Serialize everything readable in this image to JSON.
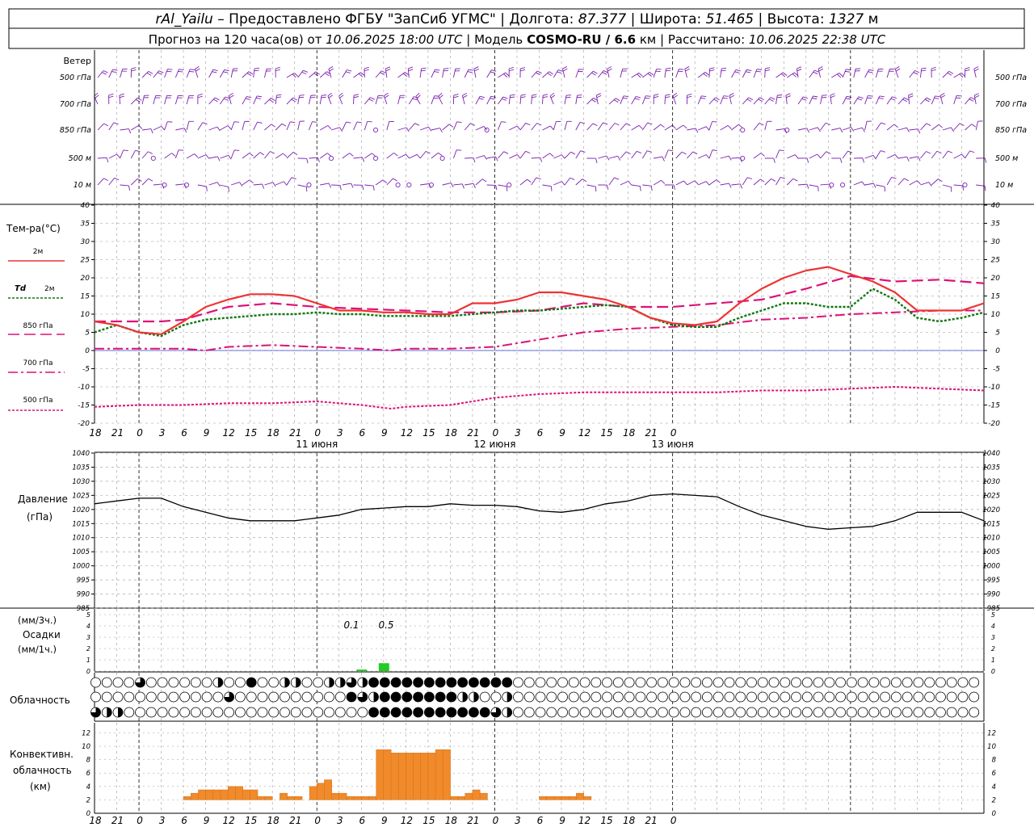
{
  "header": {
    "station": "rAl_Yailu",
    "provider": "Предоставлено ФГБУ \"ЗапСиб УГМС\"",
    "lon_label": "Долгота:",
    "lon": "87.377",
    "lat_label": "Широта:",
    "lat": "51.465",
    "alt_label": "Высота:",
    "alt": "1327",
    "alt_unit": "м",
    "forecast_prefix": "Прогноз на 120 часа(ов) от",
    "forecast_start": "10.06.2025 18:00 UTC",
    "model_label": "Модель",
    "model": "COSMO-RU / 6.6",
    "model_unit": "км",
    "calc_label": "Рассчитано:",
    "calc_time": "10.06.2025 22:38 UTC"
  },
  "time_axis": {
    "hour_labels": [
      "18",
      "21",
      "0",
      "3",
      "6",
      "9",
      "12",
      "15",
      "18",
      "21",
      "0",
      "3",
      "6",
      "9",
      "12",
      "15",
      "18",
      "21",
      "0",
      "3",
      "6",
      "9",
      "12",
      "15",
      "18",
      "21",
      "0"
    ],
    "day_labels": [
      "11 июня",
      "12 июня",
      "13 июня"
    ]
  },
  "wind_panel": {
    "title": "Ветер",
    "levels": [
      "500 гПа",
      "700 гПа",
      "850 гПа",
      "500 м",
      "10 м"
    ]
  },
  "temperature_panel": {
    "title": "Тем-ра(°С)",
    "legend": [
      {
        "label": "2м",
        "color": "#ee3333",
        "style": "solid"
      },
      {
        "label_italic": "Td",
        "label": "2м",
        "color": "#117711",
        "style": "dotted"
      },
      {
        "label": "850 гПа",
        "color": "#dd1177",
        "style": "long-dash"
      },
      {
        "label": "700 гПа",
        "color": "#dd1177",
        "style": "dash-dot"
      },
      {
        "label": "500 гПа",
        "color": "#dd1177",
        "style": "short-dash"
      }
    ]
  },
  "pressure_panel": {
    "title": "Давление",
    "unit": "(гПа)"
  },
  "precip_panel": {
    "unit_3h": "(мм/3ч.)",
    "title": "Осадки",
    "unit_1h": "(мм/1ч.)",
    "annotations": [
      "0.1",
      "0.5"
    ]
  },
  "cloud_panel": {
    "title": "Облачность"
  },
  "convective_panel": {
    "title_line1": "Конвективн.",
    "title_line2": "облачность",
    "unit": "(км)"
  },
  "colors": {
    "frame": "#000000",
    "grid": "#999999",
    "wind": "#7a1fb0",
    "t2m": "#ee3333",
    "td2m": "#117711",
    "upper": "#dd1177",
    "zero_line": "#3344cc",
    "precip": "#22cc22",
    "convective": "#f08a2a"
  },
  "chart_data": [
    {
      "type": "line",
      "panel": "temperature",
      "x_unit": "hours from 10.06.2025 18:00 UTC",
      "ylim": [
        -20,
        40
      ],
      "yticks": [
        -20,
        -15,
        -10,
        -5,
        0,
        5,
        10,
        15,
        20,
        25,
        30,
        35,
        40
      ],
      "series": [
        {
          "name": "2м",
          "x": [
            0,
            3,
            6,
            9,
            12,
            15,
            18,
            21,
            24,
            27,
            30,
            33,
            36,
            39,
            42,
            45,
            48,
            51,
            54,
            57,
            60,
            63,
            66,
            69,
            72,
            75,
            78,
            81,
            84,
            87,
            90,
            93,
            96,
            99,
            102,
            105,
            108,
            111,
            114,
            117,
            120
          ],
          "values": [
            8,
            7,
            5,
            4.5,
            8,
            12,
            14,
            15.5,
            15.5,
            15,
            13,
            11,
            11,
            10.5,
            10.5,
            10,
            10,
            13,
            13,
            14,
            16,
            16,
            15,
            14,
            12,
            9,
            7.5,
            7,
            8,
            13,
            17,
            20,
            22,
            23,
            21,
            19,
            16,
            11,
            11,
            11,
            13
          ]
        },
        {
          "name": "Td 2м",
          "x": [
            0,
            3,
            6,
            9,
            12,
            15,
            18,
            21,
            24,
            27,
            30,
            33,
            36,
            39,
            42,
            45,
            48,
            51,
            54,
            57,
            60,
            63,
            66,
            69,
            72,
            75,
            78,
            81,
            84,
            87,
            90,
            93,
            96,
            99,
            102,
            105,
            108,
            111,
            114,
            117,
            120
          ],
          "values": [
            5,
            7,
            5,
            4,
            7,
            8.5,
            9,
            9.5,
            10,
            10,
            10.5,
            10,
            10,
            9.5,
            9.5,
            9.5,
            9.5,
            10,
            10.5,
            11,
            11,
            11.5,
            12,
            12.5,
            12,
            9,
            7,
            6.5,
            6.5,
            9,
            11,
            13,
            13,
            12,
            12,
            17,
            14,
            9,
            8,
            9,
            10.5
          ]
        },
        {
          "name": "850 гПа",
          "x": [
            0,
            6,
            9,
            12,
            18,
            24,
            30,
            36,
            42,
            48,
            54,
            60,
            66,
            72,
            78,
            84,
            90,
            96,
            102,
            108,
            114,
            120
          ],
          "values": [
            8,
            8,
            8,
            8.5,
            12,
            13,
            12,
            11.5,
            11,
            10.5,
            10.5,
            11,
            13,
            12,
            12,
            13,
            14,
            17,
            20.5,
            19,
            19.5,
            18.5
          ]
        },
        {
          "name": "700 гПа",
          "x": [
            0,
            6,
            12,
            15,
            18,
            24,
            30,
            36,
            40,
            42,
            48,
            54,
            60,
            66,
            72,
            78,
            84,
            90,
            96,
            102,
            108,
            114,
            120
          ],
          "values": [
            0.5,
            0.5,
            0.5,
            0,
            1,
            1.5,
            1,
            0.5,
            0,
            0.5,
            0.5,
            1,
            3,
            5,
            6,
            6.5,
            7,
            8.5,
            9,
            10,
            10.5,
            11,
            11
          ]
        },
        {
          "name": "500 гПа",
          "x": [
            0,
            6,
            12,
            18,
            24,
            30,
            36,
            40,
            42,
            48,
            54,
            60,
            66,
            72,
            78,
            84,
            90,
            96,
            102,
            108,
            114,
            120
          ],
          "values": [
            -15.5,
            -15,
            -15,
            -14.5,
            -14.5,
            -14,
            -15,
            -16,
            -15.5,
            -15,
            -13,
            -12,
            -11.5,
            -11.5,
            -11.5,
            -11.5,
            -11,
            -11,
            -10.5,
            -10,
            -10.5,
            -11
          ]
        }
      ]
    },
    {
      "type": "line",
      "panel": "pressure",
      "x_unit": "hours from 10.06.2025 18:00 UTC",
      "ylim": [
        985,
        1040
      ],
      "yticks": [
        985,
        990,
        995,
        1000,
        1005,
        1010,
        1015,
        1020,
        1025,
        1030,
        1035,
        1040
      ],
      "series": [
        {
          "name": "Давление",
          "x": [
            0,
            3,
            6,
            9,
            12,
            15,
            18,
            21,
            24,
            27,
            30,
            33,
            36,
            39,
            42,
            45,
            48,
            51,
            54,
            57,
            60,
            63,
            66,
            69,
            72,
            75,
            78,
            81,
            84,
            87,
            90,
            93,
            96,
            99,
            102,
            105,
            108,
            111,
            114,
            117,
            120
          ],
          "values": [
            1022,
            1023,
            1024,
            1024,
            1021,
            1019,
            1017,
            1016,
            1016,
            1016,
            1017,
            1018,
            1020,
            1020.5,
            1021,
            1021,
            1022,
            1021.5,
            1021.5,
            1021,
            1019.5,
            1019,
            1020,
            1022,
            1023,
            1025,
            1025.5,
            1025,
            1024.5,
            1021,
            1018,
            1016,
            1014,
            1013,
            1013.5,
            1014,
            1016,
            1019,
            1019,
            1019,
            1016
          ]
        }
      ]
    },
    {
      "type": "bar",
      "panel": "precipitation",
      "x_unit": "hours from 10.06.2025 18:00 UTC",
      "ylim": [
        0,
        5
      ],
      "yticks": [
        0,
        1,
        2,
        3,
        4,
        5
      ],
      "series": [
        {
          "name": "Осадки",
          "x": [
            36,
            39
          ],
          "values": [
            0.1,
            0.5
          ]
        }
      ]
    },
    {
      "type": "bar",
      "panel": "convective",
      "x_unit": "hours from 10.06.2025 18:00 UTC",
      "ylim": [
        0,
        13
      ],
      "yticks": [
        0,
        2,
        4,
        6,
        8,
        10,
        12
      ],
      "series": [
        {
          "name": "Конвективн. облачность",
          "x": [
            12,
            13,
            14,
            15,
            16,
            17,
            18,
            19,
            20,
            21,
            22,
            23,
            25,
            26,
            27,
            29,
            30,
            31,
            32,
            33,
            34,
            35,
            36,
            37,
            38,
            39,
            40,
            41,
            42,
            43,
            44,
            45,
            46,
            47,
            48,
            49,
            50,
            51,
            52,
            60,
            61,
            62,
            63,
            64,
            65,
            66
          ],
          "values": [
            2.5,
            3,
            3.5,
            3.5,
            3.5,
            3.5,
            4,
            4,
            3.5,
            3.5,
            2.5,
            2.5,
            3,
            2.5,
            2.5,
            4,
            4.5,
            5,
            3,
            3,
            2.5,
            2.5,
            2.5,
            2.5,
            9.5,
            9.5,
            9,
            9,
            9,
            9,
            9,
            9,
            9.5,
            9.5,
            2.5,
            2.5,
            3,
            3.5,
            3,
            2.5,
            2.5,
            2.5,
            2.5,
            2.5,
            3,
            2.5
          ]
        }
      ]
    },
    {
      "type": "table",
      "panel": "cloud_cover",
      "rows": [
        "upper",
        "middle",
        "lower"
      ],
      "x_unit": "hours from 10.06.2025 18:00 UTC, step 1h",
      "legend": "0=clear circle, 1=quarter, 2=half, 3=three-quarter, 4=overcast",
      "upper": {
        "from": [
          4,
          11,
          14,
          17,
          18,
          21,
          22,
          23,
          24,
          25,
          27,
          28,
          29
        ],
        "to": [
          4,
          11,
          14,
          17,
          18,
          21,
          22,
          23,
          24,
          29,
          36,
          37,
          37
        ],
        "value": [
          3,
          2,
          4,
          2,
          2,
          2,
          2,
          3,
          2,
          4,
          4,
          4,
          4
        ]
      },
      "middle": {
        "from": [
          12,
          23,
          24,
          25,
          26,
          27,
          30,
          33,
          34,
          37
        ],
        "to": [
          12,
          23,
          24,
          25,
          26,
          29,
          32,
          33,
          34,
          37
        ],
        "value": [
          3,
          4,
          3,
          2,
          4,
          4,
          4,
          2,
          2,
          2
        ]
      },
      "lower": {
        "from": [
          0,
          1,
          2,
          25,
          26,
          27,
          35,
          36,
          37
        ],
        "to": [
          0,
          1,
          2,
          25,
          26,
          34,
          35,
          36,
          37
        ],
        "value": [
          3,
          2,
          2,
          4,
          4,
          4,
          4,
          3,
          2
        ]
      }
    }
  ]
}
